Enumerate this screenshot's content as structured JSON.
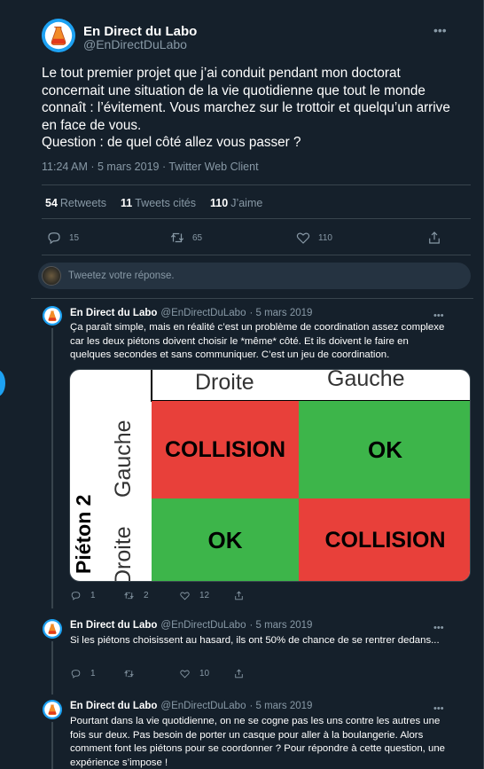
{
  "main_tweet": {
    "author_name": "En Direct du Labo",
    "handle": "@EnDirectDuLabo",
    "text": "Le tout premier projet que j’ai conduit pendant mon doctorat concernait une situation de la vie quotidienne que tout le monde connaît : l’évitement. Vous marchez sur le trottoir et quelqu’un arrive en face de vous.\nQuestion : de quel côté allez vous passer ?",
    "meta": "11:24 AM · 5 mars 2019 · Twitter Web Client",
    "stats": {
      "retweets_count": "54",
      "retweets_label": "Retweets",
      "quotes_count": "11",
      "quotes_label": "Tweets cités",
      "likes_count": "110",
      "likes_label": "J’aime"
    },
    "actions": {
      "replies": "15",
      "retweets": "65",
      "likes": "110"
    }
  },
  "reply_box": {
    "placeholder": "Tweetez votre réponse."
  },
  "replies": [
    {
      "author_name": "En Direct du Labo",
      "handle": "@EnDirectDuLabo",
      "date": "· 5 mars 2019",
      "text": "Ça paraît simple, mais en réalité c’est un problème de coordination assez complexe car les deux piétons doivent choisir le *même* côté. Et ils doivent le faire en quelques secondes et sans communiquer. C’est un jeu de coordination.",
      "actions": {
        "replies": "1",
        "retweets": "2",
        "likes": "12"
      }
    },
    {
      "author_name": "En Direct du Labo",
      "handle": "@EnDirectDuLabo",
      "date": "· 5 mars 2019",
      "text": "Si les piétons choisissent au hasard, ils ont 50% de chance de se rentrer dedans...",
      "actions": {
        "replies": "1",
        "retweets": "",
        "likes": "10"
      }
    },
    {
      "author_name": "En Direct du Labo",
      "handle": "@EnDirectDuLabo",
      "date": "· 5 mars 2019",
      "text": "Pourtant dans la vie quotidienne, on ne se cogne pas les uns contre les autres une fois sur deux. Pas besoin de porter un casque pour aller à la boulangerie. Alors comment font les piétons pour se coordonner ? Pour répondre à cette question, une expérience s’impose !"
    }
  ],
  "matrix": {
    "col_headers": [
      "Droite",
      "Gauche"
    ],
    "row_title": "Piéton 2",
    "row_headers": [
      "Gauche",
      "Droite"
    ],
    "cells": [
      [
        "COLLISION",
        "OK"
      ],
      [
        "OK",
        "COLLISION"
      ]
    ],
    "colors": {
      "collision": "#e8403a",
      "ok": "#3db54a"
    }
  },
  "colors": {
    "background": "#15202b",
    "accent": "#1da1f2",
    "muted": "#8899a6",
    "divider": "#38444d"
  },
  "icons": [
    "lab-flask-avatar-icon",
    "more-options-icon",
    "reply-icon",
    "retweet-icon",
    "like-icon",
    "share-icon"
  ]
}
